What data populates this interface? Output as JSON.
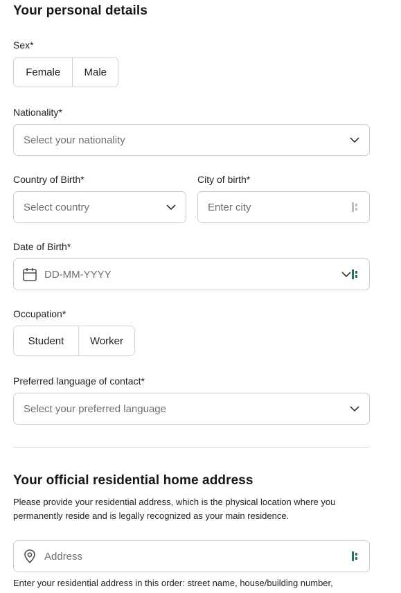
{
  "section1": {
    "title": "Your personal details"
  },
  "sex": {
    "label": "Sex*",
    "options": [
      "Female",
      "Male"
    ]
  },
  "nationality": {
    "label": "Nationality*",
    "placeholder": "Select your nationality"
  },
  "country_of_birth": {
    "label": "Country of Birth*",
    "placeholder": "Select country"
  },
  "city_of_birth": {
    "label": "City of birth*",
    "placeholder": "Enter city"
  },
  "date_of_birth": {
    "label": "Date of Birth*",
    "placeholder": "DD-MM-YYYY"
  },
  "occupation": {
    "label": "Occupation*",
    "options": [
      "Student",
      "Worker"
    ]
  },
  "preferred_language": {
    "label": "Preferred language of contact*",
    "placeholder": "Select your preferred language"
  },
  "section2": {
    "title": "Your official residential home address",
    "description": "Please provide your residential address, which is the physical location where you permanently reside and is legally recognized as your main residence."
  },
  "address": {
    "placeholder": "Address",
    "hint": "Enter your residential address in this order: street name, house/building number,"
  },
  "colors": {
    "text": "#1f1f1f",
    "border": "#c8cdd2",
    "placeholder": "#6b7075",
    "ext_icon": "#2a6f6a"
  }
}
